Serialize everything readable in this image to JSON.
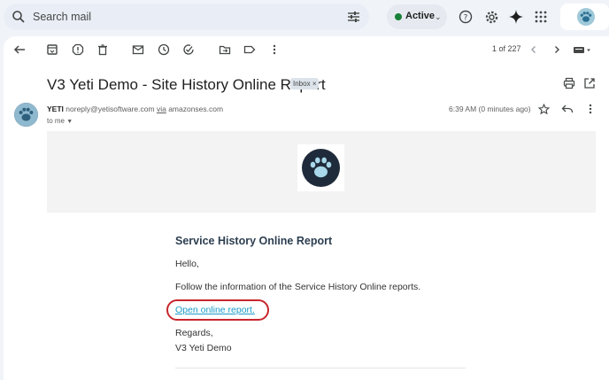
{
  "search": {
    "placeholder": "Search mail"
  },
  "status": {
    "label": "Active",
    "color": "#188038"
  },
  "topbar_icons": [
    "search-icon",
    "tune-icon",
    "help-icon",
    "settings-icon",
    "gemini-sparkle-icon",
    "apps-grid-icon"
  ],
  "toolbar": {
    "pager": "1 of 227",
    "icons": [
      "back-arrow-icon",
      "archive-icon",
      "report-spam-icon",
      "delete-icon",
      "mark-unread-icon",
      "snooze-icon",
      "add-task-icon",
      "move-to-icon",
      "label-icon",
      "more-vert-icon",
      "prev-icon",
      "next-icon",
      "keyboard-icon"
    ]
  },
  "email": {
    "subject": "V3 Yeti Demo - Site History Online Report",
    "label_chip": "Inbox",
    "label_chip_close": "×",
    "sender": {
      "name": "YETI",
      "address": "noreply@yetisoftware.com",
      "via": "via",
      "via_domain": "amazonses.com",
      "to": "to me",
      "time": "6:39 AM (0 minutes ago)"
    },
    "body": {
      "title": "Service History Online Report",
      "greeting": "Hello,",
      "message": "Follow the information of the Service History Online reports.",
      "link_text": "Open online report.",
      "closing": "Regards,",
      "signature": "V3 Yeti Demo"
    }
  },
  "colors": {
    "link": "#1a9ac9",
    "highlight_circle": "#c8262d",
    "logo_bg": "#1f2b3a"
  }
}
